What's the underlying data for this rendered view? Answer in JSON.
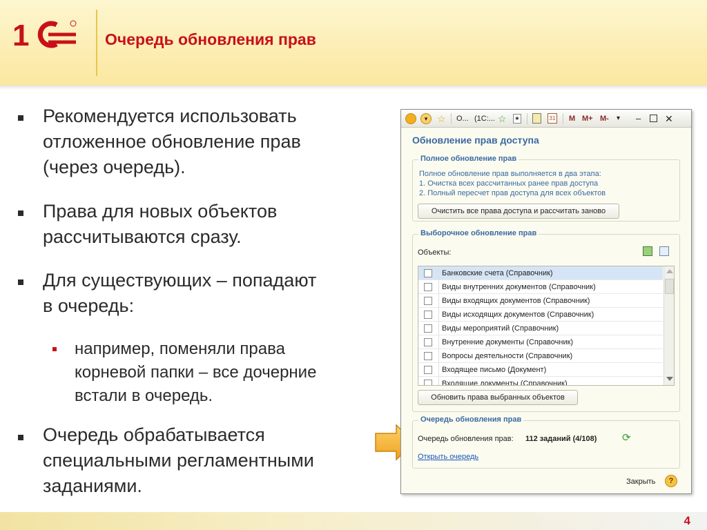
{
  "slide": {
    "title": "Очередь обновления прав",
    "page_number": "4",
    "logo_text": "1С",
    "bullets": [
      {
        "line1": "Рекомендуется использовать",
        "line2": "отложенное обновление прав",
        "line3": "(через очередь)."
      },
      {
        "line1": "Права для новых объектов",
        "line2": "рассчитываются сразу."
      },
      {
        "line1": "Для существующих – попадают",
        "line2": "в очередь:"
      },
      {
        "line1": "Очередь обрабатывается",
        "line2": "специальными регламентными",
        "line3": "заданиями."
      }
    ],
    "sub_bullet": {
      "line1": "например, поменяли права",
      "line2": "корневой папки – все дочерние",
      "line3": "встали в очередь."
    }
  },
  "window": {
    "toolbar": {
      "tab_short": "О...",
      "tab_1c": "(1С:...",
      "m_label": "M",
      "m_plus_label": "M+",
      "m_minus_label": "M-"
    },
    "title": "Обновление прав доступа",
    "full_update": {
      "label": "Полное обновление прав",
      "info_line1": "Полное обновление прав выполняется в два этапа:",
      "info_line2": "1. Очистка всех рассчитанных ранее прав доступа",
      "info_line3": "2. Полный пересчет прав доступа для всех объектов",
      "button": "Очистить все права доступа и рассчитать заново"
    },
    "selective_update": {
      "label": "Выборочное обновление прав",
      "objects_label": "Объекты:",
      "items": [
        "Банковские счета (Справочник)",
        "Виды внутренних документов (Справочник)",
        "Виды входящих документов (Справочник)",
        "Виды исходящих документов (Справочник)",
        "Виды мероприятий (Справочник)",
        "Внутренние документы (Справочник)",
        "Вопросы деятельности (Справочник)",
        "Входящее письмо (Документ)",
        "Входящие документы (Справочник)"
      ],
      "button": "Обновить права выбранных объектов"
    },
    "queue": {
      "label": "Очередь обновления прав",
      "queue_label": "Очередь обновления прав:",
      "queue_value": "112 заданий (4/108)",
      "open_link": "Открыть очередь"
    },
    "close_label": "Закрыть",
    "help_symbol": "?"
  },
  "colors": {
    "accent_red": "#c8101a",
    "window_blue": "#3b6aa1",
    "arrow_orange": "#f5a623"
  }
}
